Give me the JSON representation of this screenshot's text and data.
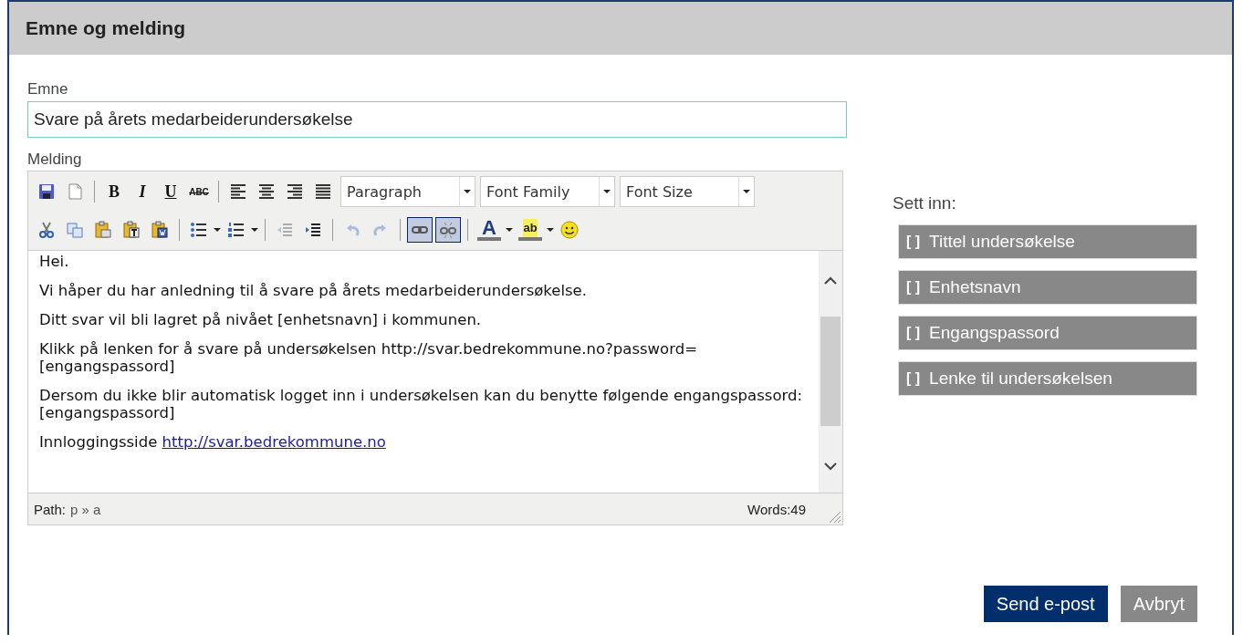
{
  "panel": {
    "title": "Emne og melding"
  },
  "subject": {
    "label": "Emne",
    "value": "Svare på årets medarbeiderundersøkelse"
  },
  "message": {
    "label": "Melding",
    "toolbar": [
      [
        {
          "kind": "icon",
          "disabled": false,
          "active": false
        },
        {
          "kind": "icon",
          "disabled": false,
          "active": false
        },
        {
          "kind": "sep"
        },
        {
          "kind": "bold",
          "label": "B",
          "disabled": false,
          "active": false
        },
        {
          "kind": "italic",
          "label": "I",
          "disabled": false,
          "active": false
        },
        {
          "kind": "underline",
          "label": "U",
          "disabled": false,
          "active": false
        },
        {
          "kind": "strike",
          "label": "ABC",
          "disabled": false,
          "active": false
        },
        {
          "kind": "sep"
        },
        {
          "kind": "icon",
          "disabled": false,
          "active": false
        },
        {
          "kind": "icon",
          "disabled": false,
          "active": false
        },
        {
          "kind": "icon",
          "disabled": false,
          "active": false
        },
        {
          "kind": "icon",
          "disabled": false,
          "active": false
        },
        {
          "kind": "select",
          "value": "Paragraph"
        },
        {
          "kind": "select",
          "value": "Font Family"
        },
        {
          "kind": "select",
          "value": "Font Size"
        }
      ],
      [
        {
          "kind": "icon",
          "disabled": false,
          "active": false
        },
        {
          "kind": "icon",
          "disabled": false,
          "active": false
        },
        {
          "kind": "icon",
          "disabled": false,
          "active": false
        },
        {
          "kind": "icon",
          "disabled": false,
          "active": false
        },
        {
          "kind": "icon",
          "disabled": false,
          "active": false
        },
        {
          "kind": "sep"
        },
        {
          "kind": "split",
          "disabled": false,
          "active": false
        },
        {
          "kind": "split",
          "disabled": false,
          "active": false
        },
        {
          "kind": "sep"
        },
        {
          "kind": "icon",
          "disabled": true,
          "active": false
        },
        {
          "kind": "icon",
          "disabled": false,
          "active": false
        },
        {
          "kind": "sep"
        },
        {
          "kind": "icon",
          "disabled": true,
          "active": false
        },
        {
          "kind": "icon",
          "disabled": true,
          "active": false
        },
        {
          "kind": "sep"
        },
        {
          "kind": "icon",
          "disabled": false,
          "active": true
        },
        {
          "kind": "icon",
          "disabled": false,
          "active": true
        },
        {
          "kind": "sep"
        },
        {
          "kind": "color",
          "label": "A",
          "disabled": false,
          "active": false
        },
        {
          "kind": "highlight",
          "label": "ab",
          "disabled": false,
          "active": false
        },
        {
          "kind": "icon",
          "disabled": false,
          "active": false
        }
      ]
    ],
    "paragraphs": [
      {
        "text": "Hei."
      },
      {
        "text": "Vi håper du har anledning til å svare på årets medarbeiderundersøkelse."
      },
      {
        "text": "Ditt svar vil bli lagret på nivået [enhetsnavn] i kommunen."
      },
      {
        "text": "Klikk på lenken for å svare på undersøkelsen http://svar.bedrekommune.no?password= [engangspassord]"
      },
      {
        "text": "Dersom du ikke blir automatisk logget inn i undersøkelsen kan du benytte følgende engangspassord: [engangspassord]"
      },
      {
        "text": "Innloggingsside ",
        "link": "http://svar.bedrekommune.no"
      }
    ],
    "path_label": "Path:",
    "path": [
      "p",
      "»",
      "a"
    ],
    "word_count": "Words:49"
  },
  "insert": {
    "title": "Sett inn:",
    "buttons": [
      {
        "marker": "[ ]",
        "label": "Tittel undersøkelse"
      },
      {
        "marker": "[ ]",
        "label": "Enhetsnavn"
      },
      {
        "marker": "[ ]",
        "label": "Engangspassord"
      },
      {
        "marker": "[ ]",
        "label": "Lenke til undersøkelsen"
      }
    ]
  },
  "actions": [
    {
      "kind": "primary",
      "label": "Send e-post"
    },
    {
      "kind": "secondary",
      "label": "Avbryt"
    }
  ]
}
